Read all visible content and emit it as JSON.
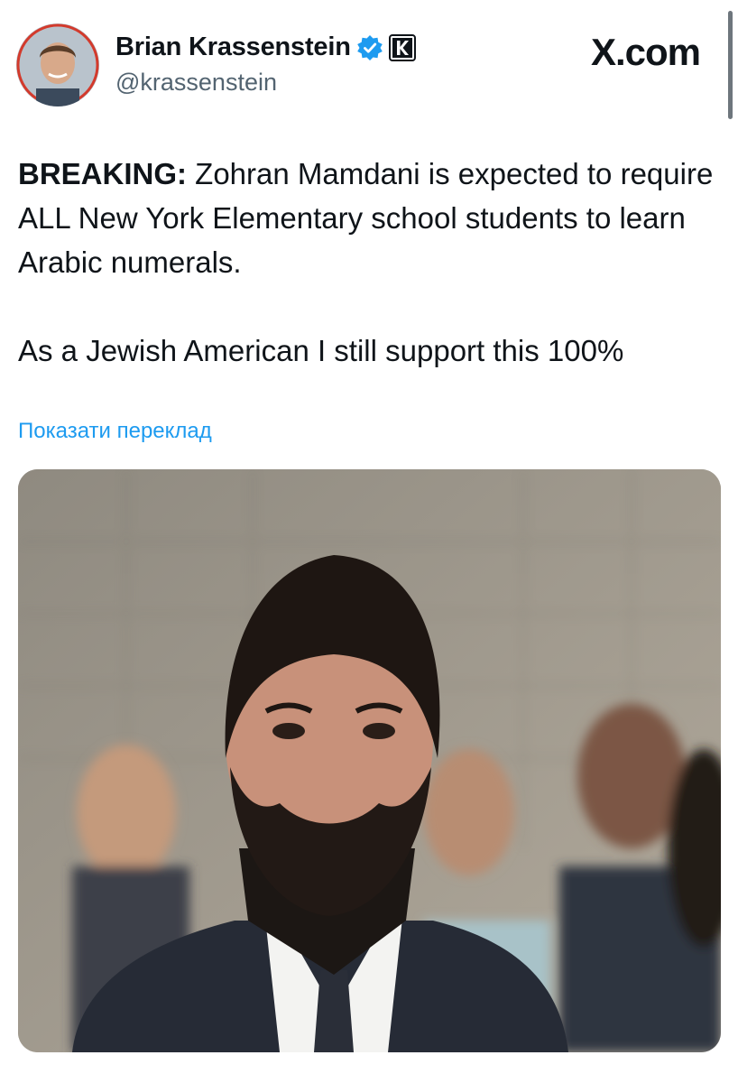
{
  "brand": {
    "label": "X.com"
  },
  "author": {
    "display_name": "Brian Krassenstein",
    "handle": "@krassenstein",
    "verified_icon": "verified-badge-icon",
    "affiliate_icon": "k-affiliate-icon"
  },
  "tweet": {
    "lead": "BREAKING:",
    "body": " Zohran Mamdani is expected to require ALL New York Elementary school students to learn Arabic numerals.",
    "body2": "As a Jewish American I still support this 100%",
    "translate_label": "Показати переклад"
  },
  "colors": {
    "link": "#1d9bf0",
    "verified": "#1d9bf0",
    "text": "#0f1419",
    "secondary": "#536471"
  }
}
